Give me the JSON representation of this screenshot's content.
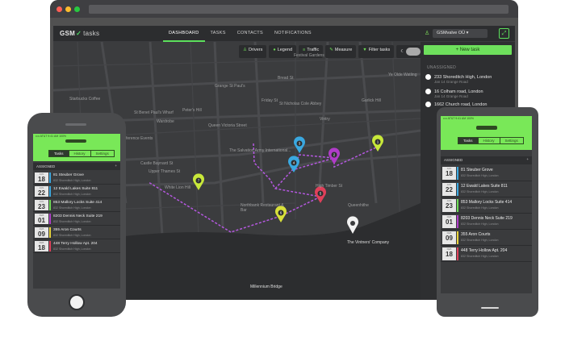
{
  "app": {
    "logo": "GSM",
    "logo_mark": "✓",
    "logo_suffix": "tasks",
    "nav": [
      "DASHBOARD",
      "TASKS",
      "CONTACTS",
      "NOTIFICATIONS"
    ],
    "active_nav": "DASHBOARD",
    "account": "GSMvalve OÜ ▾",
    "account_icon": "user-icon",
    "expand_icon": "expand-icon"
  },
  "toolbar": {
    "items": [
      {
        "icon": "user-icon",
        "label": "Drivers"
      },
      {
        "icon": "legend-icon",
        "label": "Legend"
      },
      {
        "icon": "traffic-icon",
        "label": "Traffic"
      },
      {
        "icon": "measure-icon",
        "label": "Measure"
      },
      {
        "icon": "filter-icon",
        "label": "Filter tasks"
      }
    ]
  },
  "map": {
    "labels": [
      "Festival Gardens",
      "Starbucks Coffee",
      "Grange St Paul's",
      "Ye Olde Watling",
      "St Nicholas Cole Abbey",
      "Queen Victoria Street",
      "Vintry",
      "Mermaid Conference Events Centre",
      "The Salvation Army International...",
      "St Benet Paul's Wharf",
      "Castle Baynard St",
      "Upper Thames St",
      "White Lion Hill",
      "Northbank Restaurant & Bar",
      "The Vintners' Company",
      "Millennium Bridge",
      "Wardrobe",
      "Peter's Hill",
      "Garlick Hill",
      "High Timber St",
      "Queenhithe",
      "Bread St",
      "Friday St"
    ],
    "pins": [
      {
        "n": "1",
        "color": "#c8e83a"
      },
      {
        "n": "2",
        "color": "#b13cc9"
      },
      {
        "n": "3",
        "color": "#3aa8e0"
      },
      {
        "n": "4",
        "color": "#3aa8e0"
      },
      {
        "n": "5",
        "color": "#e0405a"
      },
      {
        "n": "6",
        "color": "#d8e03a"
      },
      {
        "n": "7",
        "color": "#c8e83a"
      }
    ]
  },
  "sidebar": {
    "new_task": "+ New task",
    "unassigned": "UNASSIGNED",
    "tasks": [
      {
        "title": "233 Shoreditch High, London",
        "sub": "Jan 14 Grange Road"
      },
      {
        "title": "16 Colham road, London",
        "sub": "Jan 14 Grange Road"
      },
      {
        "title": "1662 Church road, London",
        "sub": ""
      }
    ]
  },
  "phone": {
    "status": "•••• AT&T   9:41 AM   100%",
    "tabs": [
      "Tasks",
      "History",
      "Settings"
    ],
    "assigned": "ASSIGNED",
    "plus": "+",
    "items": [
      {
        "month": "JAN",
        "day": "18",
        "color": "#3aa8e0",
        "title": "81 Steuber Grove",
        "sub": "832 Shoreditch High, London"
      },
      {
        "month": "JAN",
        "day": "22",
        "color": "#3aa8e0",
        "title": "12 Ewald Lakes Suite 811",
        "sub": "832 Shoreditch High, London"
      },
      {
        "month": "JAN",
        "day": "23",
        "color": "#6ddc55",
        "title": "853 Mallory Locks Suite 414",
        "sub": "832 Shoreditch High, London"
      },
      {
        "month": "FEB",
        "day": "01",
        "color": "#b13cc9",
        "title": "8203 Dennis Neck Suite 219",
        "sub": "832 Shoreditch High, London"
      },
      {
        "month": "FEB",
        "day": "09",
        "color": "#e8d33a",
        "title": "355 Aron Courts",
        "sub": "832 Shoreditch High, London"
      },
      {
        "month": "FEB",
        "day": "18",
        "color": "#e0405a",
        "title": "448 Terry Hollow Apt. 204",
        "sub": "832 Shoreditch High, London"
      }
    ]
  }
}
